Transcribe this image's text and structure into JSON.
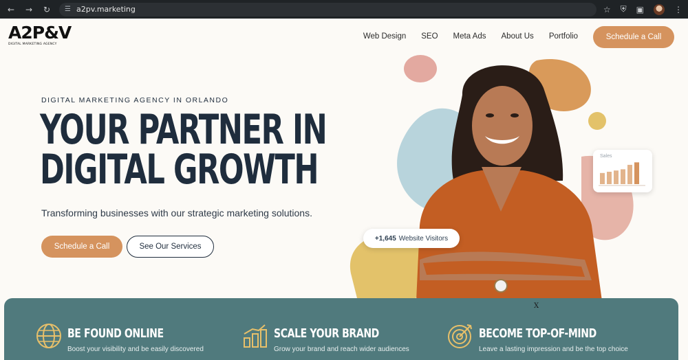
{
  "browser": {
    "url": "a2pv.marketing"
  },
  "header": {
    "logo_mark": "A2P&V",
    "logo_tagline": "DIGITAL MARKETING AGENCY",
    "nav": [
      "Web Design",
      "SEO",
      "Meta Ads",
      "About Us",
      "Portfolio"
    ],
    "cta": "Schedule a Call"
  },
  "hero": {
    "eyebrow": "DIGITAL MARKETING AGENCY IN ORLANDO",
    "headline_line1": "YOUR PARTNER IN",
    "headline_line2": "DIGITAL GROWTH",
    "subtext": "Transforming businesses with our strategic marketing solutions.",
    "primary_cta": "Schedule a Call",
    "secondary_cta": "See Our Services",
    "sales_label": "Sales",
    "visitors_count": "+1,645",
    "visitors_label": "Website Visitors",
    "sales_bars": [
      0.45,
      0.5,
      0.55,
      0.6,
      0.78,
      0.88
    ],
    "colors": {
      "accent": "#d5935e",
      "navy": "#1f2d3d",
      "teal": "#507a7d"
    }
  },
  "features": {
    "close_label": "X",
    "items": [
      {
        "title": "BE FOUND ONLINE",
        "desc": "Boost your visibility and be easily discovered",
        "icon": "globe-icon"
      },
      {
        "title": "SCALE YOUR BRAND",
        "desc": "Grow your brand and reach wider audiences",
        "icon": "bar-chart-icon"
      },
      {
        "title": "BECOME TOP-OF-MIND",
        "desc": "Leave a lasting impression and be the top choice",
        "icon": "target-icon"
      }
    ]
  }
}
